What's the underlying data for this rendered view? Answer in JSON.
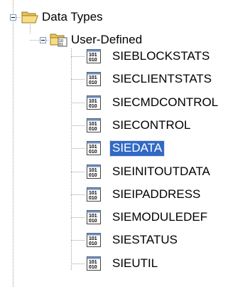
{
  "tree": {
    "root": {
      "label": "Data Types",
      "icon": "folder-open-icon"
    },
    "group": {
      "label": "User-Defined",
      "icon": "folder-binary-icon"
    },
    "items": [
      {
        "label": "SIEBLOCKSTATS",
        "icon": "binary-type-icon",
        "selected": false
      },
      {
        "label": "SIECLIENTSTATS",
        "icon": "binary-type-icon",
        "selected": false
      },
      {
        "label": "SIECMDCONTROL",
        "icon": "binary-type-icon",
        "selected": false
      },
      {
        "label": "SIECONTROL",
        "icon": "binary-type-icon",
        "selected": false
      },
      {
        "label": "SIEDATA",
        "icon": "binary-type-icon",
        "selected": true
      },
      {
        "label": "SIEINITOUTDATA",
        "icon": "binary-type-icon",
        "selected": false
      },
      {
        "label": "SIEIPADDRESS",
        "icon": "binary-type-icon",
        "selected": false
      },
      {
        "label": "SIEMODULEDEF",
        "icon": "binary-type-icon",
        "selected": false
      },
      {
        "label": "SIESTATUS",
        "icon": "binary-type-icon",
        "selected": false
      },
      {
        "label": "SIEUTIL",
        "icon": "binary-type-icon",
        "selected": false
      }
    ],
    "colors": {
      "selection": "#316ac5",
      "folder": "#f2d675",
      "expander_border": "#7f9db9"
    }
  }
}
